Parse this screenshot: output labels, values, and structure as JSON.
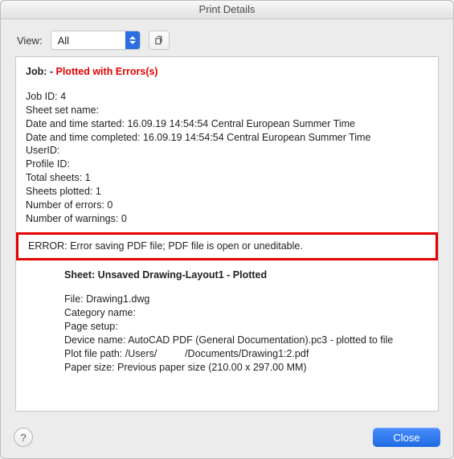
{
  "window": {
    "title": "Print Details"
  },
  "toolbar": {
    "view_label": "View:",
    "view_value": "All"
  },
  "job": {
    "prefix": "Job:",
    "dash": " - ",
    "status": "Plotted with Errors(s)",
    "lines": {
      "job_id_label": "Job ID: ",
      "job_id_value": "4",
      "sheet_set_label": "Sheet set name:",
      "sheet_set_value": "",
      "start_label": "Date and time started: ",
      "start_value": "16.09.19 14:54:54 Central European Summer Time",
      "end_label": "Date and time completed: ",
      "end_value": "16.09.19 14:54:54 Central European Summer Time",
      "userid_label": "UserID:",
      "userid_value": "",
      "profile_label": "Profile ID:",
      "profile_value": "",
      "total_sheets_label": "Total sheets: ",
      "total_sheets_value": "1",
      "sheets_plotted_label": "Sheets plotted: ",
      "sheets_plotted_value": "1",
      "errors_label": "Number of errors: ",
      "errors_value": "0",
      "warnings_label": "Number of warnings: ",
      "warnings_value": "0"
    }
  },
  "error_line": "ERROR: Error saving PDF file; PDF file is open or uneditable.",
  "sheet": {
    "title": "Sheet: Unsaved Drawing-Layout1 - Plotted",
    "file_label": "File: ",
    "file_value": "Drawing1.dwg",
    "category_label": "Category name:",
    "category_value": "",
    "pagesetup_label": "Page setup:",
    "pagesetup_value": "",
    "device_label": "Device name: ",
    "device_value": "AutoCAD PDF (General Documentation).pc3 - plotted to file",
    "plotpath_label": "Plot file path: ",
    "plotpath_value": "/Users/          /Documents/Drawing1:2.pdf",
    "paper_label": "Paper size: ",
    "paper_value": "Previous paper size (210.00 x 297.00 MM)"
  },
  "footer": {
    "help_glyph": "?",
    "close_label": "Close"
  }
}
